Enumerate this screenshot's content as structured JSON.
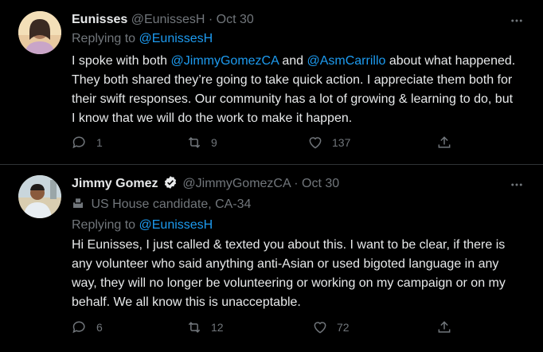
{
  "tweets": [
    {
      "name": "Eunisses",
      "handle": "@EunissesH",
      "separator": "·",
      "date": "Oct 30",
      "replying_prefix": "Replying to",
      "replying_handle": "@EunissesH",
      "text": {
        "part1": "I spoke with both ",
        "mention1": "@JimmyGomezCA",
        "part2": " and ",
        "mention2": "@AsmCarrillo",
        "part3": " about what happened. They both shared they’re going to take quick action. I appreciate them both for their swift responses. Our community has a lot of growing & learning to do, but I know that we will do the work to make it happen."
      },
      "actions": {
        "replies": "1",
        "retweets": "9",
        "likes": "137"
      }
    },
    {
      "name": "Jimmy Gomez",
      "handle": "@JimmyGomezCA",
      "separator": "·",
      "date": "Oct 30",
      "label": "US House candidate, CA-34",
      "replying_prefix": "Replying to",
      "replying_handle": "@EunissesH",
      "text": "Hi Eunisses, I just called & texted you about this. I want to be clear, if there is any volunteer who said anything anti-Asian or used bigoted language in any way, they will no longer be volunteering or working on my campaign or on my behalf. We all know this is unacceptable.",
      "actions": {
        "replies": "6",
        "retweets": "12",
        "likes": "72"
      }
    }
  ],
  "colors": {
    "background": "#000000",
    "text": "#e7e9ea",
    "muted": "#71767b",
    "link": "#1d9bf0",
    "verified": "#e7e9ea",
    "divider": "#2f3336"
  }
}
